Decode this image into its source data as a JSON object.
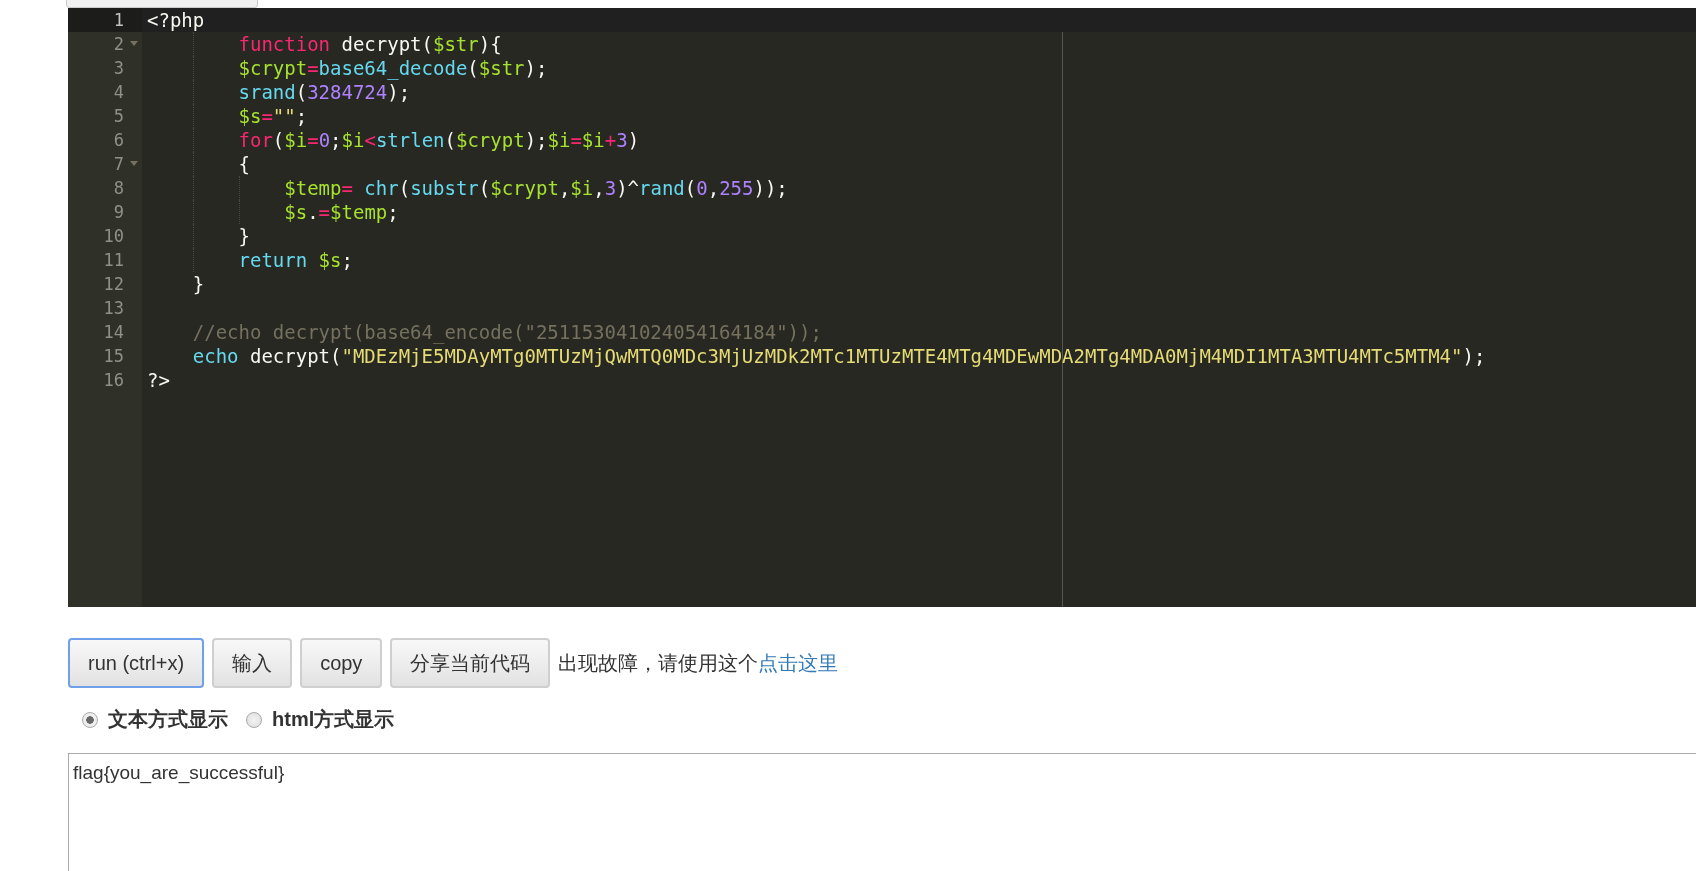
{
  "editor": {
    "lines": [
      {
        "number": "1",
        "active": true,
        "fold": false,
        "tokens": [
          {
            "kind": "plain",
            "text": "<?php"
          }
        ]
      },
      {
        "number": "2",
        "active": false,
        "fold": true,
        "tokens": [
          {
            "kind": "keyword",
            "text": "        function"
          },
          {
            "kind": "plain",
            "text": " decrypt("
          },
          {
            "kind": "var",
            "text": "$str"
          },
          {
            "kind": "plain",
            "text": "){"
          }
        ]
      },
      {
        "number": "3",
        "active": false,
        "fold": false,
        "tokens": [
          {
            "kind": "var",
            "text": "        $crypt"
          },
          {
            "kind": "op",
            "text": "="
          },
          {
            "kind": "func",
            "text": "base64_decode"
          },
          {
            "kind": "plain",
            "text": "("
          },
          {
            "kind": "var",
            "text": "$str"
          },
          {
            "kind": "plain",
            "text": ");"
          }
        ]
      },
      {
        "number": "4",
        "active": false,
        "fold": false,
        "tokens": [
          {
            "kind": "func",
            "text": "        srand"
          },
          {
            "kind": "plain",
            "text": "("
          },
          {
            "kind": "number",
            "text": "3284724"
          },
          {
            "kind": "plain",
            "text": ");"
          }
        ]
      },
      {
        "number": "5",
        "active": false,
        "fold": false,
        "tokens": [
          {
            "kind": "var",
            "text": "        $s"
          },
          {
            "kind": "op",
            "text": "="
          },
          {
            "kind": "string",
            "text": "\"\""
          },
          {
            "kind": "plain",
            "text": ";"
          }
        ]
      },
      {
        "number": "6",
        "active": false,
        "fold": false,
        "tokens": [
          {
            "kind": "keyword",
            "text": "        for"
          },
          {
            "kind": "plain",
            "text": "("
          },
          {
            "kind": "var",
            "text": "$i"
          },
          {
            "kind": "op",
            "text": "="
          },
          {
            "kind": "number",
            "text": "0"
          },
          {
            "kind": "plain",
            "text": ";"
          },
          {
            "kind": "var",
            "text": "$i"
          },
          {
            "kind": "op",
            "text": "<"
          },
          {
            "kind": "func",
            "text": "strlen"
          },
          {
            "kind": "plain",
            "text": "("
          },
          {
            "kind": "var",
            "text": "$crypt"
          },
          {
            "kind": "plain",
            "text": ");"
          },
          {
            "kind": "var",
            "text": "$i"
          },
          {
            "kind": "op",
            "text": "="
          },
          {
            "kind": "var",
            "text": "$i"
          },
          {
            "kind": "op",
            "text": "+"
          },
          {
            "kind": "number",
            "text": "3"
          },
          {
            "kind": "plain",
            "text": ")"
          }
        ]
      },
      {
        "number": "7",
        "active": false,
        "fold": true,
        "tokens": [
          {
            "kind": "plain",
            "text": "        {"
          }
        ]
      },
      {
        "number": "8",
        "active": false,
        "fold": false,
        "tokens": [
          {
            "kind": "var",
            "text": "            $temp"
          },
          {
            "kind": "op",
            "text": "= "
          },
          {
            "kind": "func",
            "text": "chr"
          },
          {
            "kind": "plain",
            "text": "("
          },
          {
            "kind": "func",
            "text": "substr"
          },
          {
            "kind": "plain",
            "text": "("
          },
          {
            "kind": "var",
            "text": "$crypt"
          },
          {
            "kind": "plain",
            "text": ","
          },
          {
            "kind": "var",
            "text": "$i"
          },
          {
            "kind": "plain",
            "text": ","
          },
          {
            "kind": "number",
            "text": "3"
          },
          {
            "kind": "plain",
            "text": ")^"
          },
          {
            "kind": "func",
            "text": "rand"
          },
          {
            "kind": "plain",
            "text": "("
          },
          {
            "kind": "number",
            "text": "0"
          },
          {
            "kind": "plain",
            "text": ","
          },
          {
            "kind": "number",
            "text": "255"
          },
          {
            "kind": "plain",
            "text": "));"
          }
        ]
      },
      {
        "number": "9",
        "active": false,
        "fold": false,
        "tokens": [
          {
            "kind": "var",
            "text": "            $s"
          },
          {
            "kind": "plain",
            "text": "."
          },
          {
            "kind": "op",
            "text": "="
          },
          {
            "kind": "var",
            "text": "$temp"
          },
          {
            "kind": "plain",
            "text": ";"
          }
        ]
      },
      {
        "number": "10",
        "active": false,
        "fold": false,
        "tokens": [
          {
            "kind": "plain",
            "text": "        }"
          }
        ]
      },
      {
        "number": "11",
        "active": false,
        "fold": false,
        "tokens": [
          {
            "kind": "func",
            "text": "        return"
          },
          {
            "kind": "var",
            "text": " $s"
          },
          {
            "kind": "plain",
            "text": ";"
          }
        ]
      },
      {
        "number": "12",
        "active": false,
        "fold": false,
        "tokens": [
          {
            "kind": "plain",
            "text": "    }"
          }
        ]
      },
      {
        "number": "13",
        "active": false,
        "fold": false
      },
      {
        "number": "14",
        "active": false,
        "fold": false,
        "tokens": [
          {
            "kind": "comment",
            "text": "    //echo decrypt(base64_encode(\"251153041024054164184\"));"
          }
        ]
      },
      {
        "number": "15",
        "active": false,
        "fold": false,
        "tokens": [
          {
            "kind": "func",
            "text": "    echo"
          },
          {
            "kind": "plain",
            "text": " decrypt("
          },
          {
            "kind": "string",
            "text": "\"MDEzMjE5MDAyMTg0MTUzMjQwMTQ0MDc3MjUzMDk2MTc1MTUzMTE4MTg4MDEwMDA2MTg4MDA0MjM4MDI1MTA3MTU4MTc5MTM4\""
          },
          {
            "kind": "plain",
            "text": ");"
          }
        ]
      },
      {
        "number": "16",
        "active": false,
        "fold": false,
        "tokens": [
          {
            "kind": "plain",
            "text": "?>"
          }
        ]
      }
    ]
  },
  "buttons": [
    {
      "label": "run (ctrl+x)",
      "selected": true
    },
    {
      "label": "输入",
      "selected": false
    },
    {
      "label": "copy",
      "selected": false
    },
    {
      "label": "分享当前代码",
      "selected": false
    }
  ],
  "notice": {
    "text": "出现故障，请使用这个",
    "link": "点击这里"
  },
  "display_modes": [
    {
      "label": "文本方式显示",
      "selected": true
    },
    {
      "label": "html方式显示",
      "selected": false
    }
  ],
  "output": {
    "value": "flag{you_are_successful}"
  }
}
